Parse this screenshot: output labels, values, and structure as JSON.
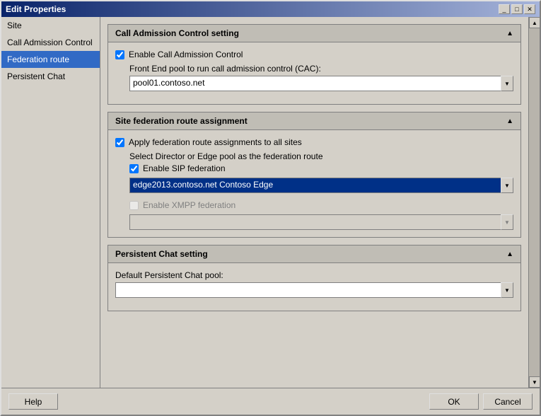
{
  "window": {
    "title": "Edit Properties",
    "controls": {
      "minimize": "_",
      "maximize": "□",
      "close": "✕"
    }
  },
  "sidebar": {
    "items": [
      {
        "id": "site",
        "label": "Site"
      },
      {
        "id": "call-admission-control",
        "label": "Call Admission Control"
      },
      {
        "id": "federation-route",
        "label": "Federation route"
      },
      {
        "id": "persistent-chat",
        "label": "Persistent Chat"
      }
    ]
  },
  "sections": {
    "cac": {
      "header": "Call Admission Control setting",
      "enable_label": "Enable Call Admission Control",
      "enable_checked": true,
      "frontend_label": "Front End pool to run call admission control (CAC):",
      "frontend_value": "pool01.contoso.net"
    },
    "federation": {
      "header": "Site federation route assignment",
      "apply_label": "Apply federation route assignments to all sites",
      "apply_checked": true,
      "select_label": "Select Director or Edge pool as the federation route",
      "sip_label": "Enable SIP federation",
      "sip_checked": true,
      "sip_value": "edge2013.contoso.net   Contoso   Edge",
      "xmpp_label": "Enable XMPP federation",
      "xmpp_checked": false,
      "xmpp_disabled": true
    },
    "persistent_chat": {
      "header": "Persistent Chat setting",
      "pool_label": "Default Persistent Chat pool:",
      "pool_value": ""
    }
  },
  "footer": {
    "help_label": "Help",
    "ok_label": "OK",
    "cancel_label": "Cancel"
  }
}
